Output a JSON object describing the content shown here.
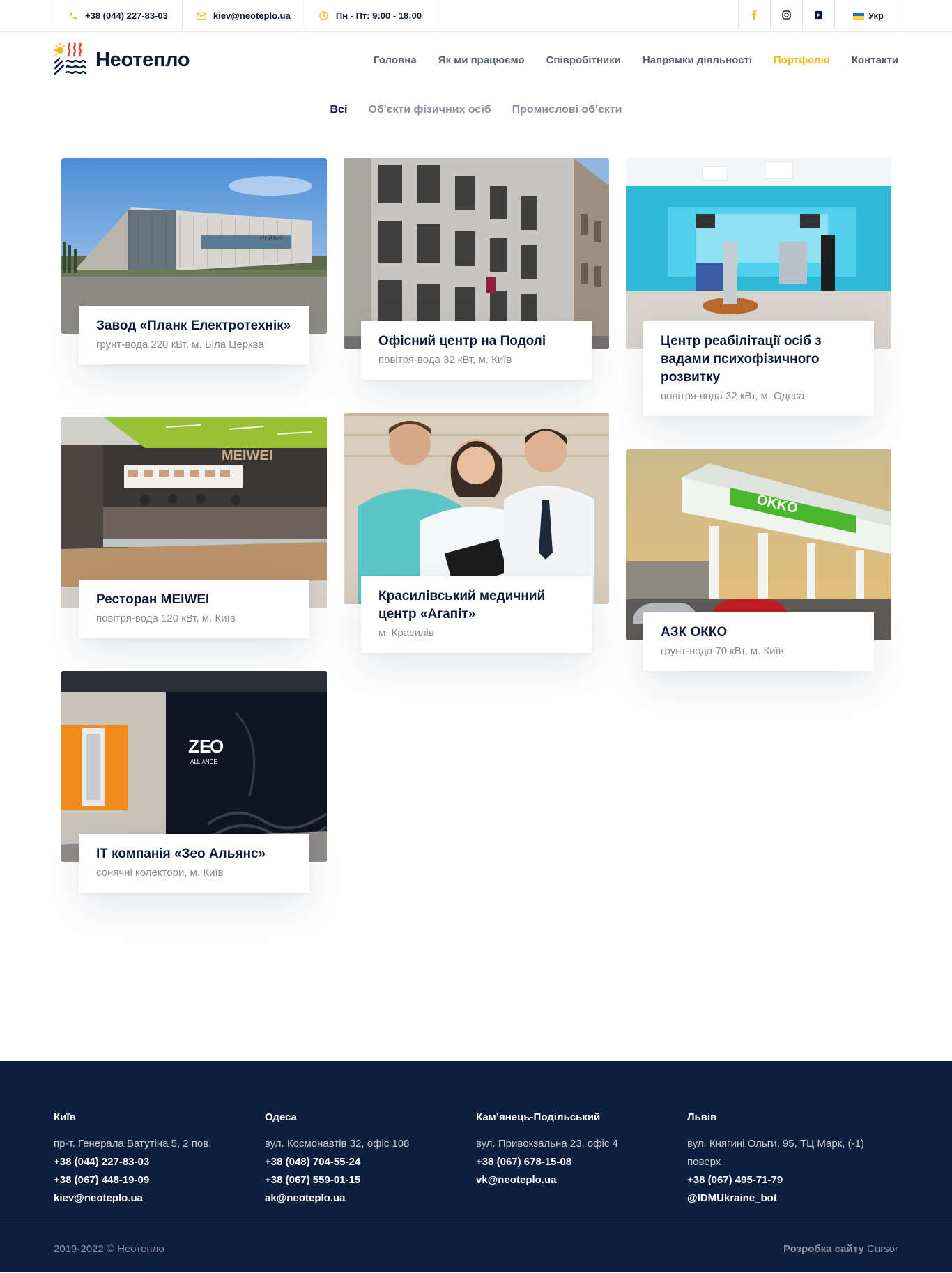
{
  "topbar": {
    "phone": "+38 (044) 227-83-03",
    "email": "kiev@neoteplo.ua",
    "hours": "Пн - Пт: 9:00 - 18:00",
    "language": "Укр"
  },
  "header": {
    "logo_text": "Неотепло",
    "nav": [
      {
        "label": "Головна"
      },
      {
        "label": "Як ми працюємо"
      },
      {
        "label": "Співробітники"
      },
      {
        "label": "Напрямки діяльності"
      },
      {
        "label": "Портфоліо",
        "active": true
      },
      {
        "label": "Контакти"
      }
    ]
  },
  "filters": [
    {
      "label": "Всі",
      "active": true
    },
    {
      "label": "Об'єкти фізичних осіб"
    },
    {
      "label": "Промислові об'єкти"
    }
  ],
  "portfolio": [
    {
      "title": "Завод «Планк Електротехнік»",
      "subtitle": "грунт-вода 220 кВт, м. Біла Церква",
      "image": "industrial-building-photo"
    },
    {
      "title": "Офісний центр на Подолі",
      "subtitle": "повітря-вода 32 кВт, м. Київ",
      "image": "office-building-photo"
    },
    {
      "title": "Центр реабілітації осіб з вадами психофізичного розвитку",
      "subtitle": "повітря-вода 32 кВт, м. Одеса",
      "image": "rehab-center-photo"
    },
    {
      "title": "Ресторан MEIWEI",
      "subtitle": "повітря-вода 120 кВт, м. Київ",
      "image": "restaurant-photo",
      "sign": "MEIWEI"
    },
    {
      "title": "Красилівський медичний центр «Агапіт»",
      "subtitle": "м. Красилів",
      "image": "medical-staff-photo"
    },
    {
      "title": "АЗК ОККО",
      "subtitle": "грунт-вода 70 кВт, м. Київ",
      "image": "gas-station-photo",
      "sign": "OKKO"
    },
    {
      "title": "IT компанія «Зео Альянс»",
      "subtitle": "сонячні колектори, м. Київ",
      "image": "it-office-photo",
      "sign": "ZEO ALLIANCE"
    }
  ],
  "footer": {
    "offices": [
      {
        "city": "Київ",
        "lines": [
          "пр-т. Генерала Ватутіна 5, 2 пов."
        ],
        "contacts": [
          "+38 (044) 227-83-03",
          "+38 (067) 448-19-09",
          "kiev@neoteplo.ua"
        ]
      },
      {
        "city": "Одеса",
        "lines": [
          "вул. Космонавтів 32, офіс 108"
        ],
        "contacts": [
          "+38 (048) 704-55-24",
          "+38 (067) 559-01-15",
          "ak@neoteplo.ua"
        ]
      },
      {
        "city": "Кам’янець-Подільський",
        "lines": [
          "вул. Привокзальна 23, офіс 4"
        ],
        "contacts": [
          "+38 (067) 678-15-08",
          "vk@neoteplo.ua"
        ]
      },
      {
        "city": "Львів",
        "lines": [
          "вул. Княгині Ольги, 95, ТЦ Марк, (-1) поверх"
        ],
        "contacts": [
          "+38 (067) 495-71-79",
          "@IDMUkraine_bot"
        ]
      }
    ],
    "copyright": "2019-2022 © Неотепло",
    "dev_label": "Розробка сайту",
    "dev_name": "Cursor"
  },
  "colors": {
    "accent": "#f5bb1d",
    "navy": "#0d1f3e",
    "text": "#0d1b36",
    "muted": "#868b95"
  }
}
